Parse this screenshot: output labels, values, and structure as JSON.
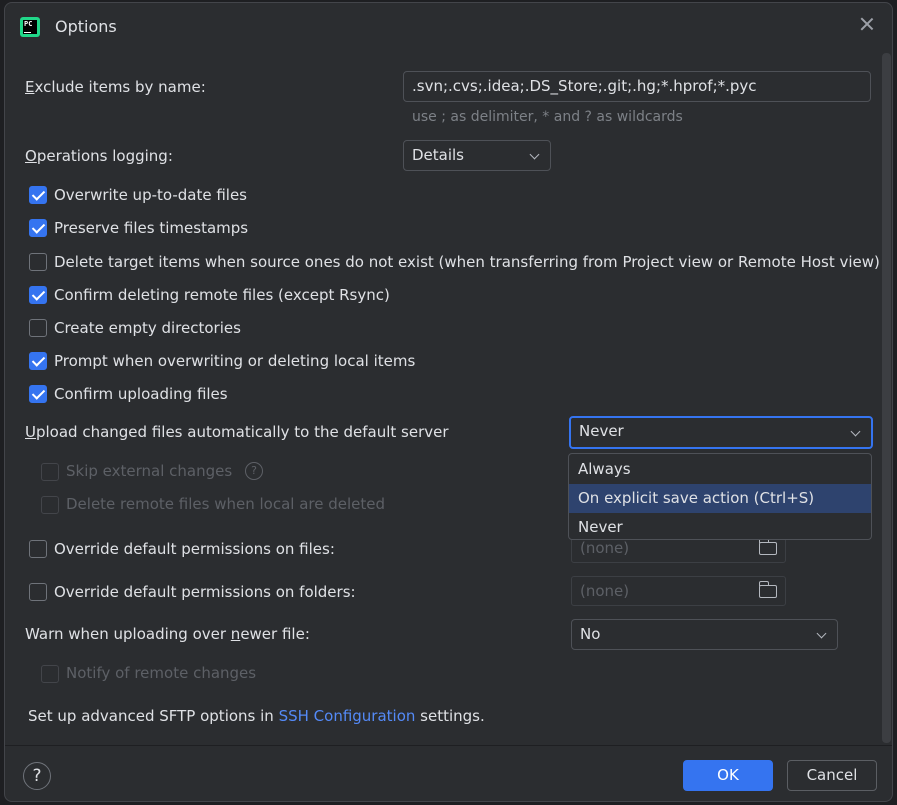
{
  "title": "Options",
  "exclude": {
    "label": "Exclude items by name:",
    "value": ".svn;.cvs;.idea;.DS_Store;.git;.hg;*.hprof;*.pyc",
    "hint": "use ; as delimiter, * and ? as wildcards"
  },
  "logging": {
    "label": "Operations logging:",
    "value": "Details"
  },
  "checkboxes": [
    {
      "label": "Overwrite up-to-date files",
      "checked": true
    },
    {
      "label": "Preserve files timestamps",
      "checked": true
    },
    {
      "label": "Delete target items when source ones do not exist (when transferring from Project view or Remote Host view)",
      "checked": false
    },
    {
      "label": "Confirm deleting remote files (except Rsync)",
      "checked": true
    },
    {
      "label": "Create empty directories",
      "checked": false
    },
    {
      "label": "Prompt when overwriting or deleting local items",
      "checked": true
    },
    {
      "label": "Confirm uploading files",
      "checked": true
    }
  ],
  "upload": {
    "label": "Upload changed files automatically to the default server",
    "value": "Never",
    "options": [
      "Always",
      "On explicit save action (Ctrl+S)",
      "Never"
    ],
    "highlighted": "On explicit save action (Ctrl+S)"
  },
  "sub_options": {
    "skip": "Skip external changes",
    "delete_remote": "Delete remote files when local are deleted"
  },
  "permissions": {
    "files_label": "Override default permissions on files:",
    "folders_label": "Override default permissions on folders:",
    "files_placeholder": "(none)",
    "folders_placeholder": "(none)"
  },
  "warn": {
    "label": "Warn when uploading over newer file:",
    "value": "No"
  },
  "notify": "Notify of remote changes",
  "sftp": {
    "prefix": "Set up advanced SFTP options in ",
    "link": "SSH Configuration",
    "suffix": " settings."
  },
  "footer": {
    "help": "?",
    "ok": "OK",
    "cancel": "Cancel"
  },
  "colors": {
    "accent": "#3574f0",
    "background": "#2b2d30",
    "link": "#548af7",
    "selection": "#2e436e"
  }
}
